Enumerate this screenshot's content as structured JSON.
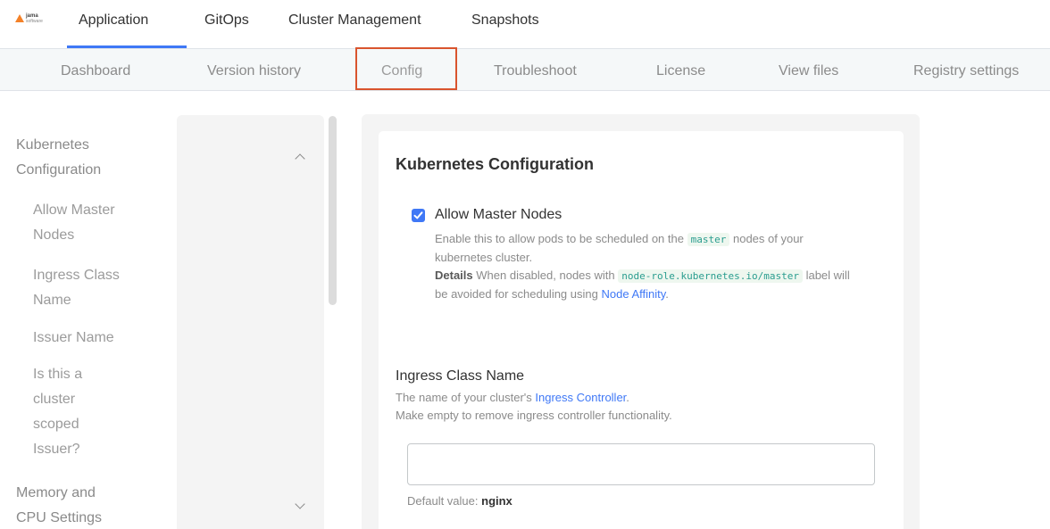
{
  "brand": {
    "logo_line1": "jama",
    "logo_line2": "software"
  },
  "top_nav": {
    "items": [
      {
        "label": "Application",
        "active": true
      },
      {
        "label": "GitOps"
      },
      {
        "label": "Cluster Management"
      },
      {
        "label": "Snapshots"
      }
    ]
  },
  "sub_nav": {
    "items": [
      {
        "label": "Dashboard"
      },
      {
        "label": "Version history"
      },
      {
        "label": "Config",
        "active": true
      },
      {
        "label": "Troubleshoot"
      },
      {
        "label": "License"
      },
      {
        "label": "View files"
      },
      {
        "label": "Registry settings"
      }
    ]
  },
  "sidebar": {
    "groups": [
      {
        "label": "Kubernetes Configuration",
        "expanded": true,
        "items": [
          {
            "label": "Allow Master Nodes"
          },
          {
            "label": "Ingress Class Name"
          },
          {
            "label": "Issuer Name"
          },
          {
            "label": "Is this a cluster scoped Issuer?"
          }
        ]
      },
      {
        "label": "Memory and CPU Settings",
        "expanded": false
      }
    ]
  },
  "main": {
    "section_title": "Kubernetes Configuration",
    "allow_master": {
      "checked": true,
      "label": "Allow Master Nodes",
      "desc_pre": "Enable this to allow pods to be scheduled on the",
      "desc_code": "master",
      "desc_post": "nodes of your kubernetes cluster.",
      "details_label": "Details",
      "details_pre": "When disabled, nodes with",
      "details_code": "node-role.kubernetes.io/master",
      "details_post": "label will be avoided for scheduling using",
      "details_link": "Node Affinity",
      "details_end": "."
    },
    "ingress": {
      "label": "Ingress Class Name",
      "help_pre": "The name of your cluster's",
      "help_link": "Ingress Controller",
      "help_end": ".",
      "help_line2": "Make empty to remove ingress controller functionality.",
      "value": "",
      "placeholder": "",
      "default_label": "Default value:",
      "default_value": "nginx"
    }
  },
  "colors": {
    "accent": "#3f78f6",
    "highlight_box": "#d9542e",
    "subnav_bg": "#f5f8f9"
  }
}
